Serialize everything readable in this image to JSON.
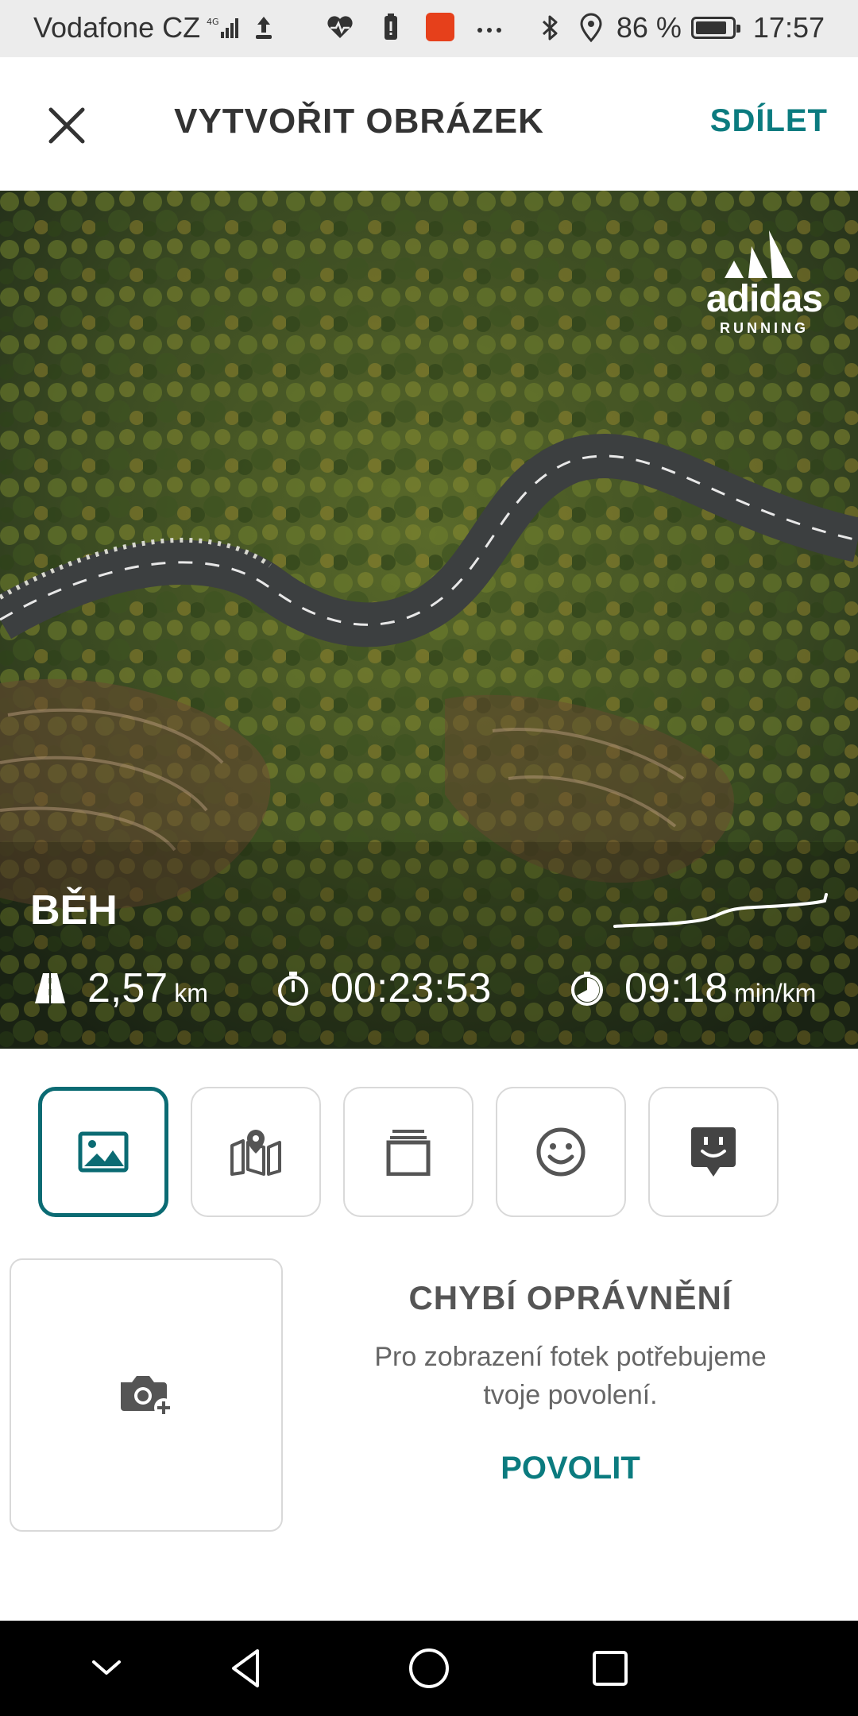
{
  "status_bar": {
    "carrier": "Vodafone CZ",
    "network": "4G",
    "battery_percent": "86 %",
    "battery_level": 0.86,
    "time": "17:57",
    "icons": [
      "signal-icon",
      "upload-icon",
      "heart-rate-icon",
      "battery-saver-icon",
      "aliexpress-icon",
      "more-icon",
      "bluetooth-icon",
      "location-icon",
      "battery-icon"
    ]
  },
  "header": {
    "title": "VYTVOŘIT OBRÁZEK",
    "share_label": "SDÍLET",
    "close_icon": "close-icon"
  },
  "preview": {
    "brand_word": "adidas",
    "brand_sub": "RUNNING",
    "activity": "BĚH",
    "stats": [
      {
        "icon": "road-icon",
        "value": "2,57",
        "unit": "km"
      },
      {
        "icon": "stopwatch-icon",
        "value": "00:23:53",
        "unit": ""
      },
      {
        "icon": "pace-icon",
        "value": "09:18",
        "unit": "min/km"
      }
    ]
  },
  "tools": [
    {
      "name": "image-icon",
      "active": true
    },
    {
      "name": "map-icon",
      "active": false
    },
    {
      "name": "layers-icon",
      "active": false
    },
    {
      "name": "smiley-icon",
      "active": false
    },
    {
      "name": "sticker-icon",
      "active": false
    }
  ],
  "photos": {
    "add_icon": "add-photo-icon",
    "permission_title": "CHYBÍ OPRÁVNĚNÍ",
    "permission_text_line1": "Pro zobrazení fotek potřebujeme",
    "permission_text_line2": "tvoje povolení.",
    "allow_label": "POVOLIT"
  },
  "colors": {
    "accent": "#0b7b7f",
    "active_border": "#0b6b73",
    "nav_background": "#000000"
  },
  "navbar": [
    "hide-keyboard-icon",
    "back-icon",
    "home-icon",
    "recents-icon"
  ]
}
